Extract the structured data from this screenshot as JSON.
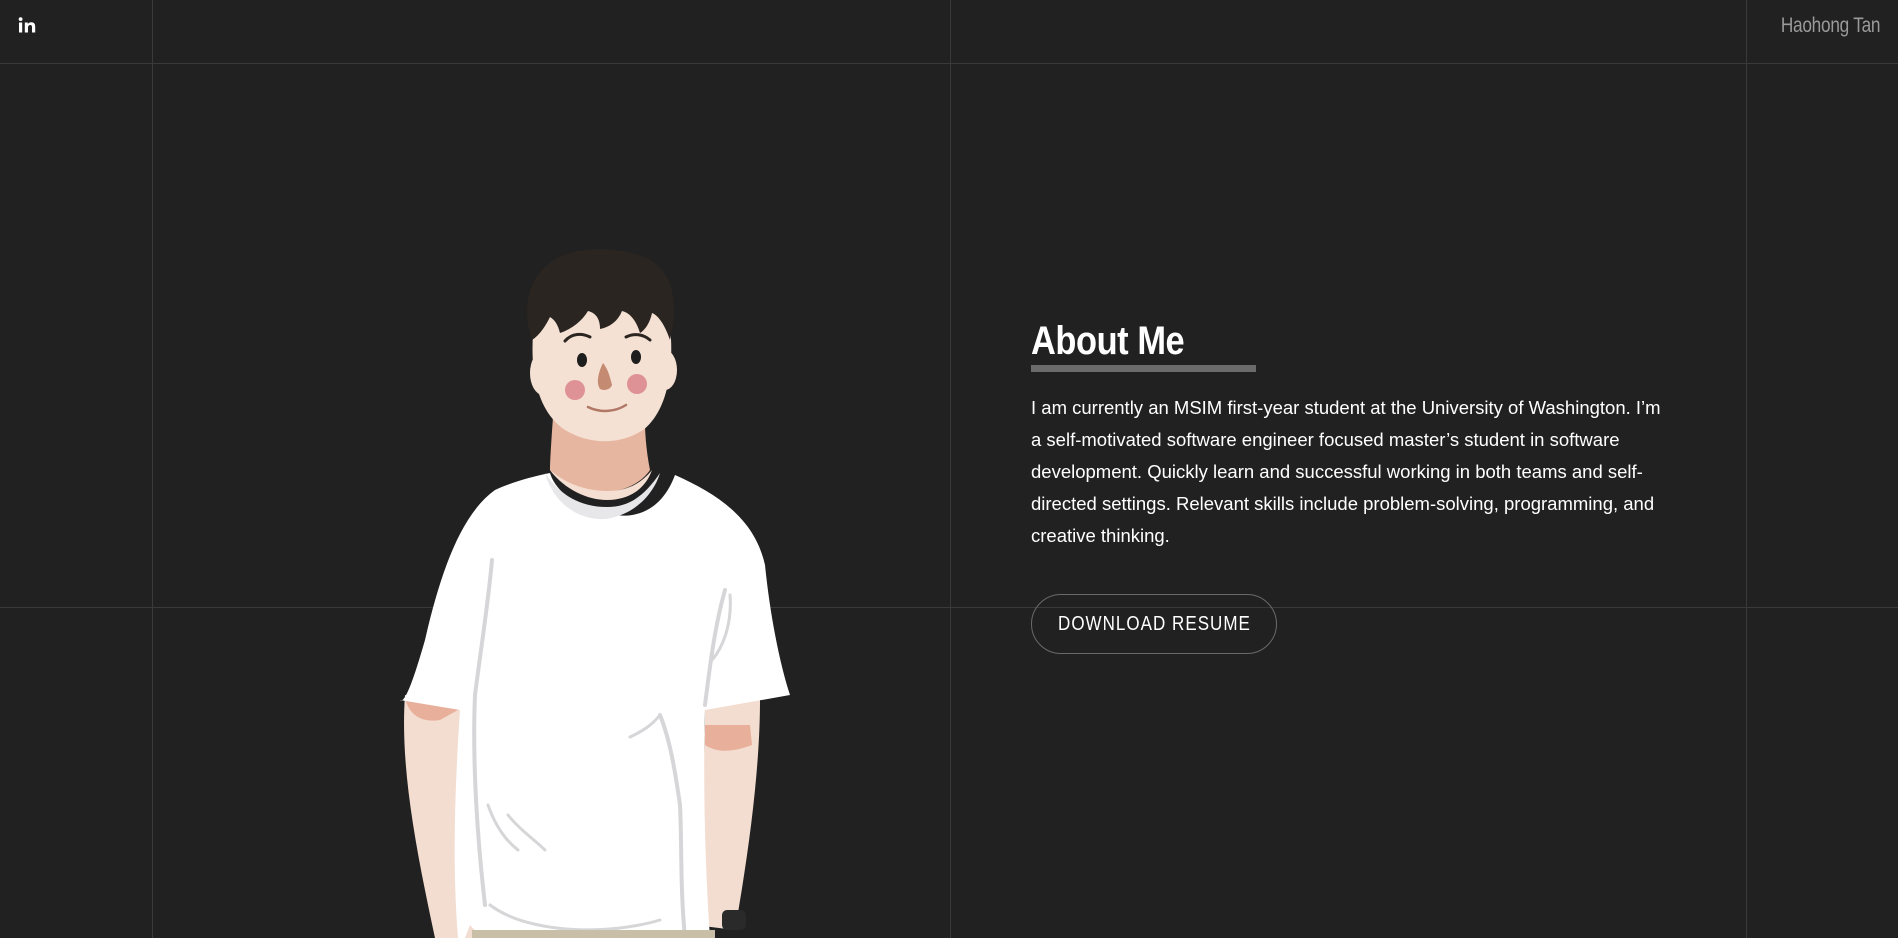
{
  "header": {
    "linkedin_icon": "linkedin-icon",
    "brand_name": "Haohong Tan"
  },
  "illustration": {
    "icon": "person-avatar-illustration"
  },
  "about": {
    "title": "About Me",
    "body": "I am currently an MSIM first-year student at the University of Washington. I’m a self-motivated software engineer focused master’s student in software development. Quickly learn and successful working in both teams and self-directed settings. Relevant skills include problem-solving, programming, and creative thinking.",
    "button_label": "DOWNLOAD RESUME"
  },
  "colors": {
    "background": "#212121",
    "grid_line": "#3a3a3a",
    "text": "#ffffff",
    "muted_text": "#9a9a9a",
    "underline": "#6b6b6b"
  }
}
